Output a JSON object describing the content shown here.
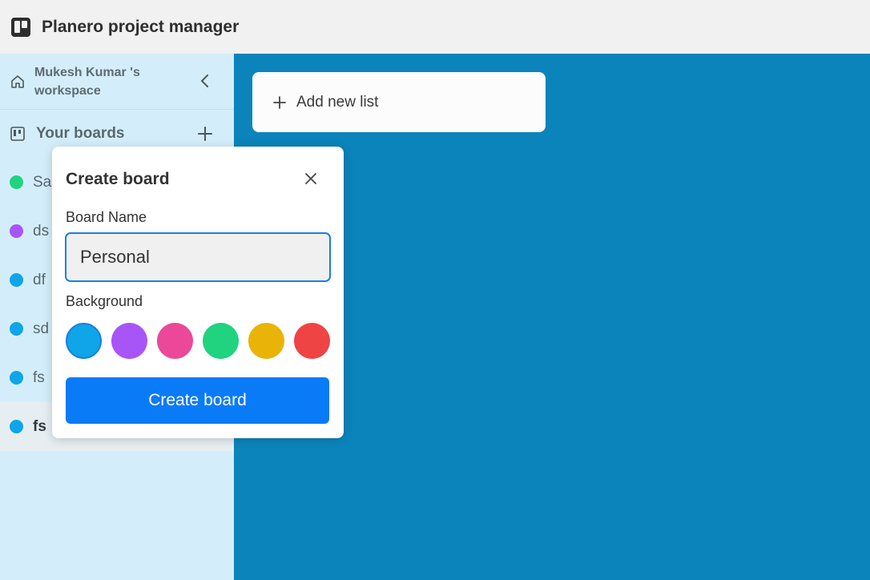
{
  "app": {
    "title": "Planero project manager"
  },
  "sidebar": {
    "workspace_name": "Mukesh Kumar 's workspace",
    "boards_label": "Your boards",
    "boards": [
      {
        "label": "Sa",
        "color": "#20d37f",
        "active": false
      },
      {
        "label": "ds",
        "color": "#a855f7",
        "active": false
      },
      {
        "label": "df",
        "color": "#0ea5e9",
        "active": false
      },
      {
        "label": "sd",
        "color": "#0ea5e9",
        "active": false
      },
      {
        "label": "fs",
        "color": "#0ea5e9",
        "active": false
      },
      {
        "label": "fs",
        "color": "#0ea5e9",
        "active": true
      }
    ]
  },
  "main": {
    "add_list_label": "Add new list",
    "background_color": "#0b84bb"
  },
  "create_board": {
    "title": "Create board",
    "name_label": "Board Name",
    "name_value": "Personal",
    "background_label": "Background",
    "colors": [
      "#0ea5e9",
      "#a855f7",
      "#ec4899",
      "#20d37f",
      "#eab308",
      "#ef4444"
    ],
    "selected_color": "#0ea5e9",
    "submit_label": "Create board"
  }
}
